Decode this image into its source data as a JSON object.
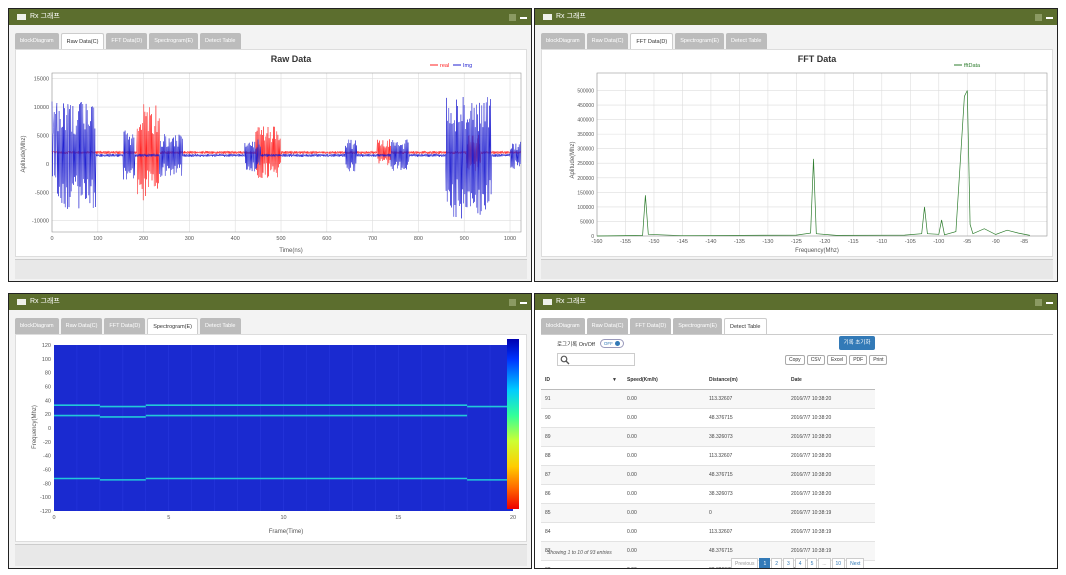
{
  "window_title": "Rx 그래프",
  "tabs": [
    "blockDiagram",
    "Raw Data(C)",
    "FFT Data(D)",
    "Spectrogram(E)",
    "Detect Table"
  ],
  "raw": {
    "title": "Raw Data",
    "xlabel": "Time(ns)",
    "ylabel": "Aplitude(Mhz)",
    "legend": [
      "real",
      "Img"
    ],
    "xticks": [
      "0",
      "100",
      "200",
      "300",
      "400",
      "500",
      "600",
      "700",
      "800",
      "900",
      "1000"
    ],
    "yticks": [
      "15000",
      "10000",
      "5000",
      "0",
      "-5000",
      "-10000"
    ]
  },
  "fft": {
    "title": "FFT Data",
    "xlabel": "Frequency(Mhz)",
    "ylabel": "Aplitude(Mhz)",
    "legend": [
      "fftData"
    ],
    "xticks": [
      "-160",
      "-155",
      "-150",
      "-145",
      "-140",
      "-135",
      "-130",
      "-125",
      "-120",
      "-115",
      "-110",
      "-105",
      "-100",
      "-95",
      "-90",
      "-85"
    ],
    "yticks": [
      "500000",
      "450000",
      "400000",
      "350000",
      "300000",
      "250000",
      "200000",
      "150000",
      "100000",
      "50000",
      "0"
    ]
  },
  "spec": {
    "xlabel": "Frame(Time)",
    "ylabel": "Frequency(Mhz)",
    "xticks": [
      "0",
      "5",
      "10",
      "15",
      "20"
    ],
    "yticks": [
      "120",
      "100",
      "80",
      "60",
      "40",
      "20",
      "0",
      "-20",
      "-40",
      "-60",
      "-80",
      "-100",
      "-120"
    ]
  },
  "detect": {
    "log_label": "로그기록 On/Off",
    "toggle_label": "OFF",
    "reset_button": "기록 초기화",
    "export_buttons": [
      "Copy",
      "CSV",
      "Excel",
      "PDF",
      "Print"
    ],
    "columns": [
      "ID",
      "Speed(Km/h)",
      "Distance(m)",
      "Date"
    ],
    "rows": [
      [
        "91",
        "0.00",
        "113.32607",
        "2016/7/7 10:38:20"
      ],
      [
        "90",
        "0.00",
        "48.376715",
        "2016/7/7 10:38:20"
      ],
      [
        "89",
        "0.00",
        "38.326073",
        "2016/7/7 10:38:20"
      ],
      [
        "88",
        "0.00",
        "113.32607",
        "2016/7/7 10:38:20"
      ],
      [
        "87",
        "0.00",
        "48.376715",
        "2016/7/7 10:38:20"
      ],
      [
        "86",
        "0.00",
        "38.326073",
        "2016/7/7 10:38:20"
      ],
      [
        "85",
        "0.00",
        "0",
        "2016/7/7 10:38:19"
      ],
      [
        "84",
        "0.00",
        "113.32607",
        "2016/7/7 10:38:19"
      ],
      [
        "83",
        "0.00",
        "48.376715",
        "2016/7/7 10:38:19"
      ],
      [
        "82",
        "0.00",
        "38.326073",
        "2016/7/7 10:38:19"
      ]
    ],
    "showing": "Showing 1 to 10 of 93 entries",
    "pagination": [
      "Previous",
      "1",
      "2",
      "3",
      "4",
      "5",
      "...",
      "10",
      "Next"
    ]
  },
  "chart_data": [
    {
      "type": "line",
      "title": "Raw Data",
      "xlabel": "Time(ns)",
      "ylabel": "Aplitude(Mhz)",
      "xlim": [
        0,
        1024
      ],
      "ylim": [
        -12000,
        16000
      ],
      "series": [
        {
          "name": "real",
          "color": "#ff2020",
          "baseline": 2000,
          "bursts": [
            [
              185,
              235,
              9000
            ],
            [
              445,
              500,
              5000
            ],
            [
              710,
              740,
              2500
            ],
            [
              905,
              935,
              3500
            ]
          ]
        },
        {
          "name": "Img",
          "color": "#1f1fd0",
          "baseline": 1500,
          "bursts": [
            [
              0,
              95,
              10000
            ],
            [
              155,
              180,
              5000
            ],
            [
              235,
              285,
              4000
            ],
            [
              420,
              455,
              3000
            ],
            [
              640,
              665,
              3000
            ],
            [
              740,
              780,
              3000
            ],
            [
              860,
              960,
              12000
            ],
            [
              1000,
              1024,
              2500
            ]
          ]
        }
      ]
    },
    {
      "type": "line",
      "title": "FFT Data",
      "xlabel": "Frequency(Mhz)",
      "ylabel": "Aplitude(Mhz)",
      "xlim": [
        -160,
        -81
      ],
      "ylim": [
        0,
        560000
      ],
      "series": [
        {
          "name": "fftData",
          "color": "#2e7d2e",
          "x": [
            -160,
            -152,
            -151.5,
            -151,
            -145,
            -125,
            -122.5,
            -122,
            -121.5,
            -118,
            -106,
            -103,
            -102.5,
            -102,
            -100,
            -99.5,
            -99,
            -97,
            -95.5,
            -95,
            -94.5,
            -94,
            -92,
            -90,
            -88,
            -86,
            -84
          ],
          "y": [
            0,
            2000,
            140000,
            6000,
            1000,
            3000,
            10000,
            265000,
            8000,
            2000,
            3000,
            8000,
            100000,
            8000,
            6000,
            55000,
            4000,
            15000,
            480000,
            500000,
            40000,
            8000,
            25000,
            5000,
            20000,
            10000,
            2000
          ]
        }
      ]
    },
    {
      "type": "heatmap",
      "xlabel": "Frame(Time)",
      "ylabel": "Frequency(Mhz)",
      "xlim": [
        0,
        20
      ],
      "ylim": [
        -120,
        120
      ],
      "background": "#1a2ad0",
      "lines": [
        {
          "segments": [
            [
              0,
              2,
              33
            ],
            [
              2,
              4,
              31
            ],
            [
              4,
              18,
              33
            ],
            [
              18,
              20,
              31
            ]
          ]
        },
        {
          "segments": [
            [
              0,
              2,
              18
            ],
            [
              2,
              4,
              16
            ],
            [
              4,
              18,
              18
            ]
          ]
        },
        {
          "segments": [
            [
              0,
              2,
              -73
            ],
            [
              2,
              4,
              -75
            ],
            [
              4,
              18,
              -73
            ],
            [
              18,
              20,
              -75
            ]
          ]
        }
      ]
    }
  ]
}
